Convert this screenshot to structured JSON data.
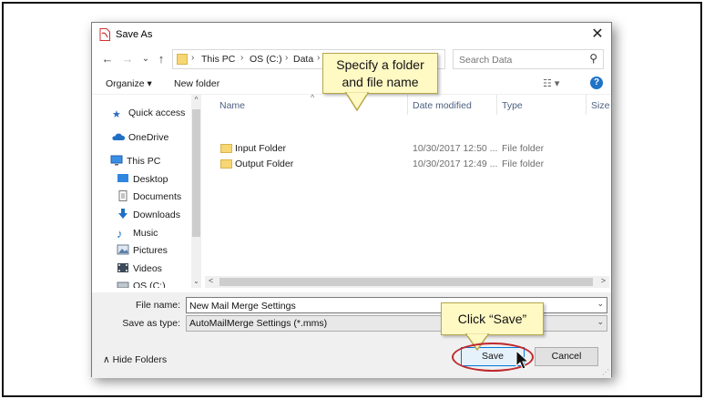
{
  "dialog": {
    "title": "Save As",
    "close": "✕"
  },
  "nav": {
    "back": "←",
    "forward": "→",
    "recent": "⌄",
    "up": "↑",
    "breadcrumb": [
      "This PC",
      "OS (C:)",
      "Data"
    ],
    "search_placeholder": "Search Data"
  },
  "toolbar": {
    "organize": "Organize ▾",
    "new_folder": "New folder",
    "view": "☷ ▾",
    "help": "?"
  },
  "sidebar": {
    "items": [
      {
        "label": "Quick access",
        "icon": "star-icon"
      },
      {
        "label": "OneDrive",
        "icon": "cloud-icon"
      },
      {
        "label": "This PC",
        "icon": "computer-icon"
      },
      {
        "label": "Desktop",
        "icon": "desktop-icon"
      },
      {
        "label": "Documents",
        "icon": "documents-icon"
      },
      {
        "label": "Downloads",
        "icon": "download-arrow-icon"
      },
      {
        "label": "Music",
        "icon": "music-note-icon"
      },
      {
        "label": "Pictures",
        "icon": "pictures-icon"
      },
      {
        "label": "Videos",
        "icon": "video-icon"
      },
      {
        "label": "OS (C:)",
        "icon": "drive-icon"
      }
    ]
  },
  "files": {
    "columns": [
      "Name",
      "Date modified",
      "Type",
      "Size"
    ],
    "rows": [
      {
        "name": "Input Folder",
        "date": "10/30/2017 12:50 ...",
        "type": "File folder"
      },
      {
        "name": "Output Folder",
        "date": "10/30/2017 12:49 ...",
        "type": "File folder"
      }
    ]
  },
  "form": {
    "filename_label": "File name:",
    "filename_value": "New Mail Merge Settings",
    "type_label": "Save as type:",
    "type_value": "AutoMailMerge Settings (*.mms)",
    "hide_folders": "∧  Hide Folders",
    "save": "Save",
    "cancel": "Cancel"
  },
  "callouts": {
    "folder": [
      "Specify a folder",
      "and file name"
    ],
    "save": "Click “Save”"
  },
  "colors": {
    "callout_bg": "#fff9c4",
    "ring": "#c0282d",
    "accent": "#0078d7",
    "folder": "#f7d774"
  }
}
